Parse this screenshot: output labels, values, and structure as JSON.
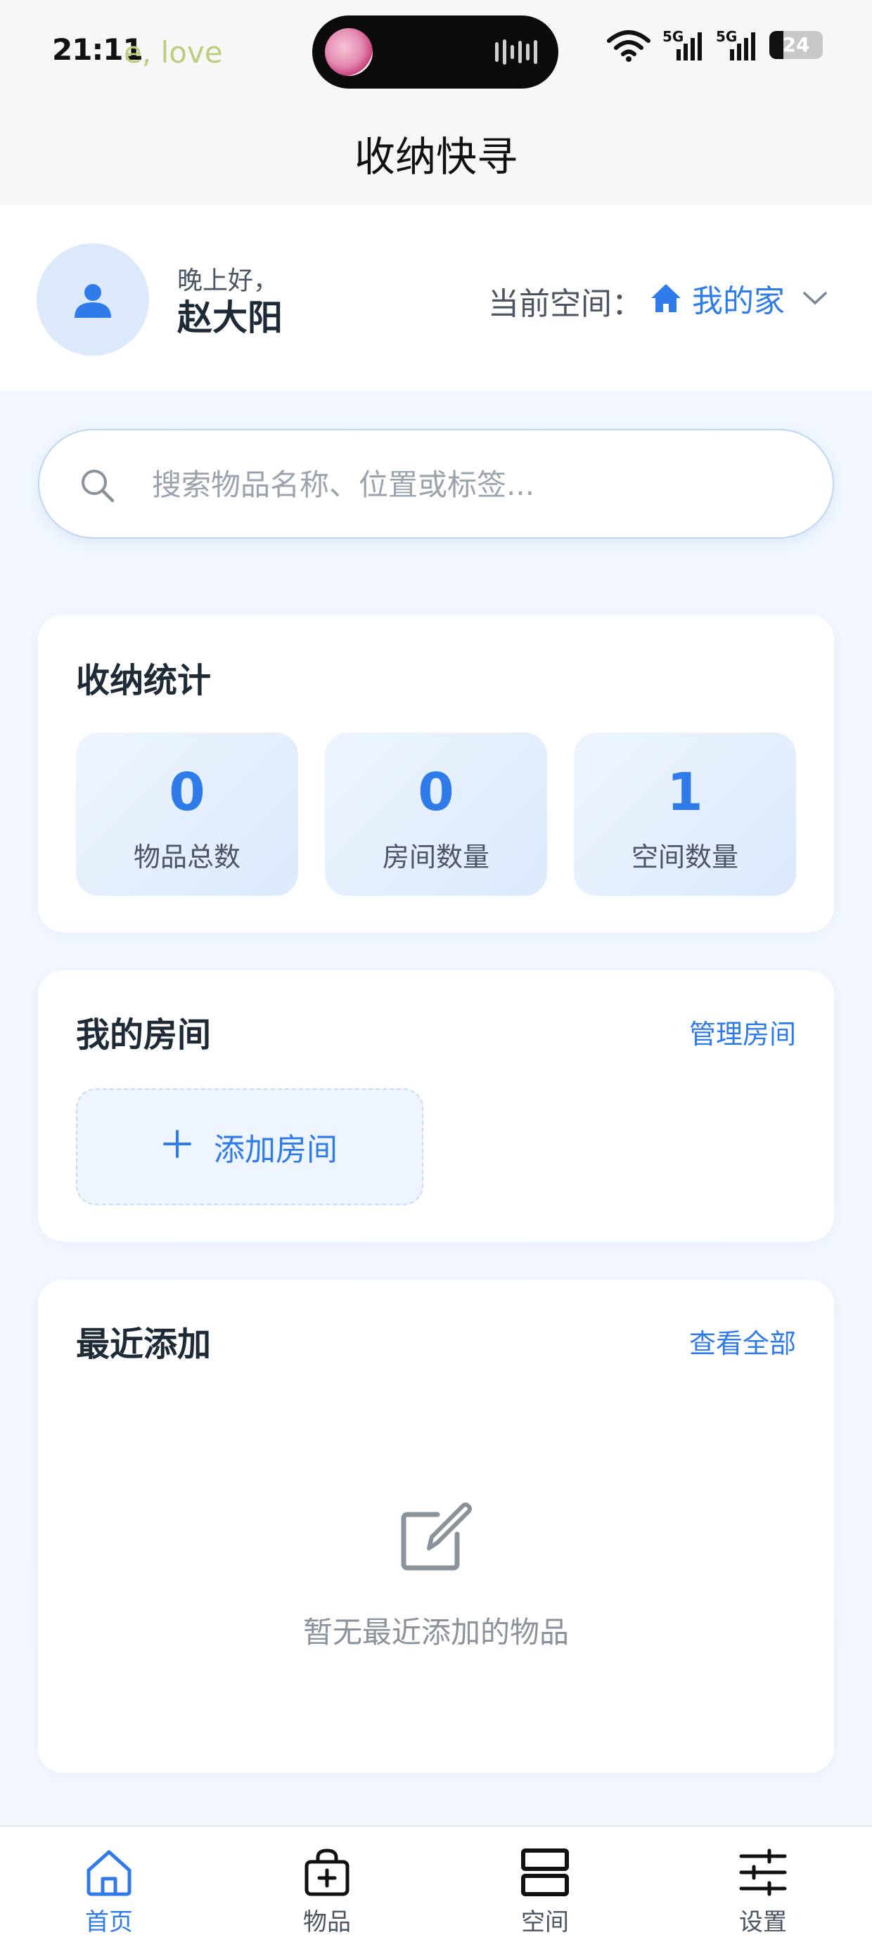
{
  "status_bar": {
    "time": "21:11",
    "song_fragment": "e, love",
    "network_1": "5G",
    "network_2": "5G",
    "battery": "24"
  },
  "nav": {
    "title": "收纳快寻"
  },
  "header": {
    "greeting": "晚上好，",
    "username": "赵大阳",
    "space_label": "当前空间：",
    "space_name": "我的家"
  },
  "search": {
    "placeholder": "搜索物品名称、位置或标签..."
  },
  "stats": {
    "title": "收纳统计",
    "items": [
      {
        "value": "0",
        "label": "物品总数"
      },
      {
        "value": "0",
        "label": "房间数量"
      },
      {
        "value": "1",
        "label": "空间数量"
      }
    ]
  },
  "rooms": {
    "title": "我的房间",
    "manage_link": "管理房间",
    "add_label": "添加房间"
  },
  "recent": {
    "title": "最近添加",
    "view_all_link": "查看全部",
    "empty_text": "暂无最近添加的物品"
  },
  "tabbar": {
    "tabs": [
      {
        "label": "首页",
        "icon": "home-icon",
        "active": true
      },
      {
        "label": "物品",
        "icon": "bag-plus-icon",
        "active": false
      },
      {
        "label": "空间",
        "icon": "stack-icon",
        "active": false
      },
      {
        "label": "设置",
        "icon": "sliders-icon",
        "active": false
      }
    ]
  },
  "colors": {
    "accent": "#2f7bea",
    "page_bg": "#eef4fd",
    "card_bg": "#ffffff"
  }
}
